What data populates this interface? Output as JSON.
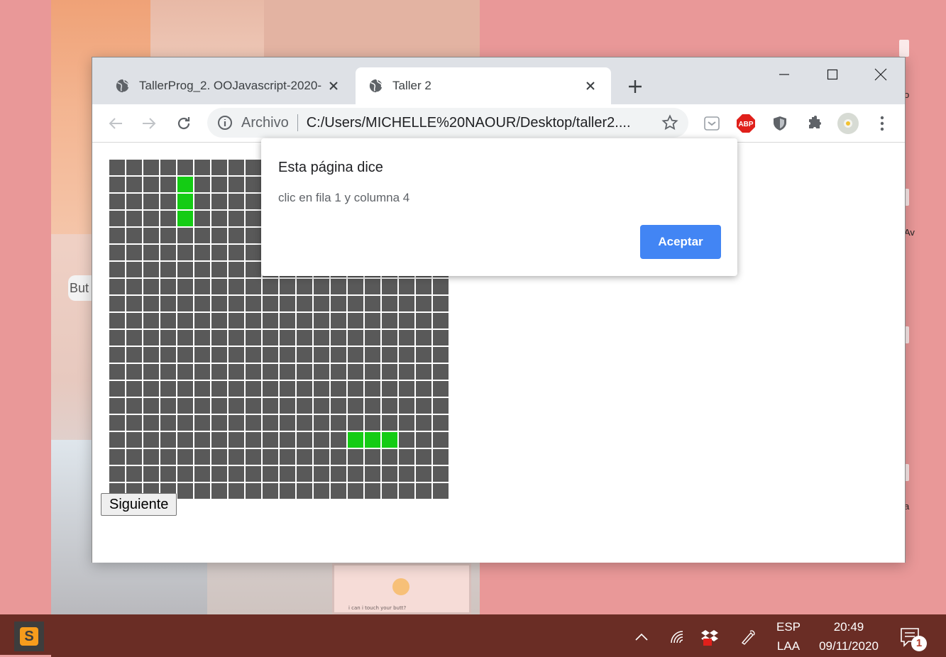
{
  "desktop": {
    "wallpaper_bubble_text": "But",
    "wallpaper_card_caption": "i can i touch your butt?",
    "icon_label_partials": [
      "o",
      "Av",
      "a"
    ]
  },
  "browser": {
    "tabs": [
      {
        "title": "TallerProg_2. OOJavascript-2020-",
        "active": false
      },
      {
        "title": "Taller 2",
        "active": true
      }
    ],
    "new_tab_label": "+",
    "omnibox": {
      "security_chip": "Archivo",
      "url": "C:/Users/MICHELLE%20NAOUR/Desktop/taller2...."
    },
    "extensions": [
      "pocket-icon",
      "adblock-plus-icon",
      "shield-icon",
      "puzzle-icon",
      "profile-avatar",
      "menu-icon"
    ],
    "extension_abp_text": "ABP"
  },
  "page": {
    "grid": {
      "rows": 20,
      "cols": 20,
      "active_cells": [
        [
          1,
          4
        ],
        [
          2,
          4
        ],
        [
          3,
          4
        ],
        [
          16,
          14
        ],
        [
          16,
          15
        ],
        [
          16,
          16
        ]
      ],
      "off_color": "#595959",
      "on_color": "#14cc14"
    },
    "next_button": "Siguiente"
  },
  "dialog": {
    "title": "Esta página dice",
    "message": "clic en fila 1 y columna 4",
    "ok_button": "Aceptar",
    "accent": "#4285f4"
  },
  "taskbar": {
    "app_letter": "S",
    "lang_top": "ESP",
    "lang_bottom": "LAA",
    "time": "20:49",
    "date": "09/11/2020",
    "notification_count": "1"
  }
}
